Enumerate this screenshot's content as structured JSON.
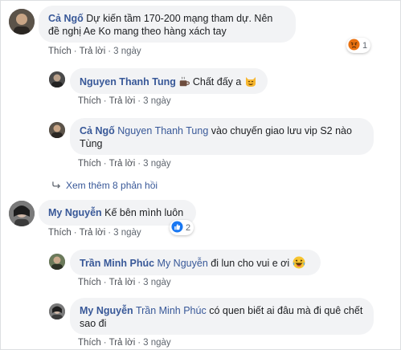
{
  "comments": [
    {
      "author": "Cả Ngố",
      "text": "Dự kiến tầm 170-200 mạng tham dự. Nên đề nghị Ae Ko mang theo hàng xách tay",
      "actions": {
        "like": "Thích",
        "reply": "Trả lời",
        "time": "3 ngày"
      },
      "reaction": {
        "type": "angry",
        "count": "1"
      }
    },
    {
      "author": "Nguyen Thanh Tung",
      "text": "Chất đấy a",
      "actions": {
        "like": "Thích",
        "reply": "Trả lời",
        "time": "3 ngày"
      }
    },
    {
      "author": "Cả Ngố",
      "mention": "Nguyen Thanh Tung",
      "text": "vào chuyến giao lưu vip S2 nào Tùng",
      "actions": {
        "like": "Thích",
        "reply": "Trả lời",
        "time": "3 ngày"
      }
    },
    {
      "author": "My Nguyễn",
      "text": "Kế bên mình luôn",
      "actions": {
        "like": "Thích",
        "reply": "Trả lời",
        "time": "3 ngày"
      },
      "reaction": {
        "type": "like",
        "count": "2"
      }
    },
    {
      "author": "Trần Minh Phúc",
      "mention": "My Nguyễn",
      "text": "đi lun cho vui e ơi",
      "actions": {
        "like": "Thích",
        "reply": "Trả lời",
        "time": "3 ngày"
      }
    },
    {
      "author": "My Nguyễn",
      "mention": "Trần Minh Phúc",
      "text": "có quen biết ai đâu mà đi quê chết sao đi",
      "actions": {
        "like": "Thích",
        "reply": "Trả lời",
        "time": "3 ngày"
      }
    }
  ],
  "more_replies": "Xem thêm 8 phản hồi",
  "icons": {
    "coffee": "coffee-icon",
    "cat": "smiling-cat-icon",
    "laugh": "laughing-emoji-icon",
    "angry": "angry-reaction-icon",
    "like": "like-reaction-icon",
    "reply_arrow": "reply-arrow-icon"
  },
  "colors": {
    "link": "#385898",
    "bubble": "#f2f3f5",
    "meta": "#606770",
    "like": "#1877f2",
    "angry": "#e9710f"
  }
}
